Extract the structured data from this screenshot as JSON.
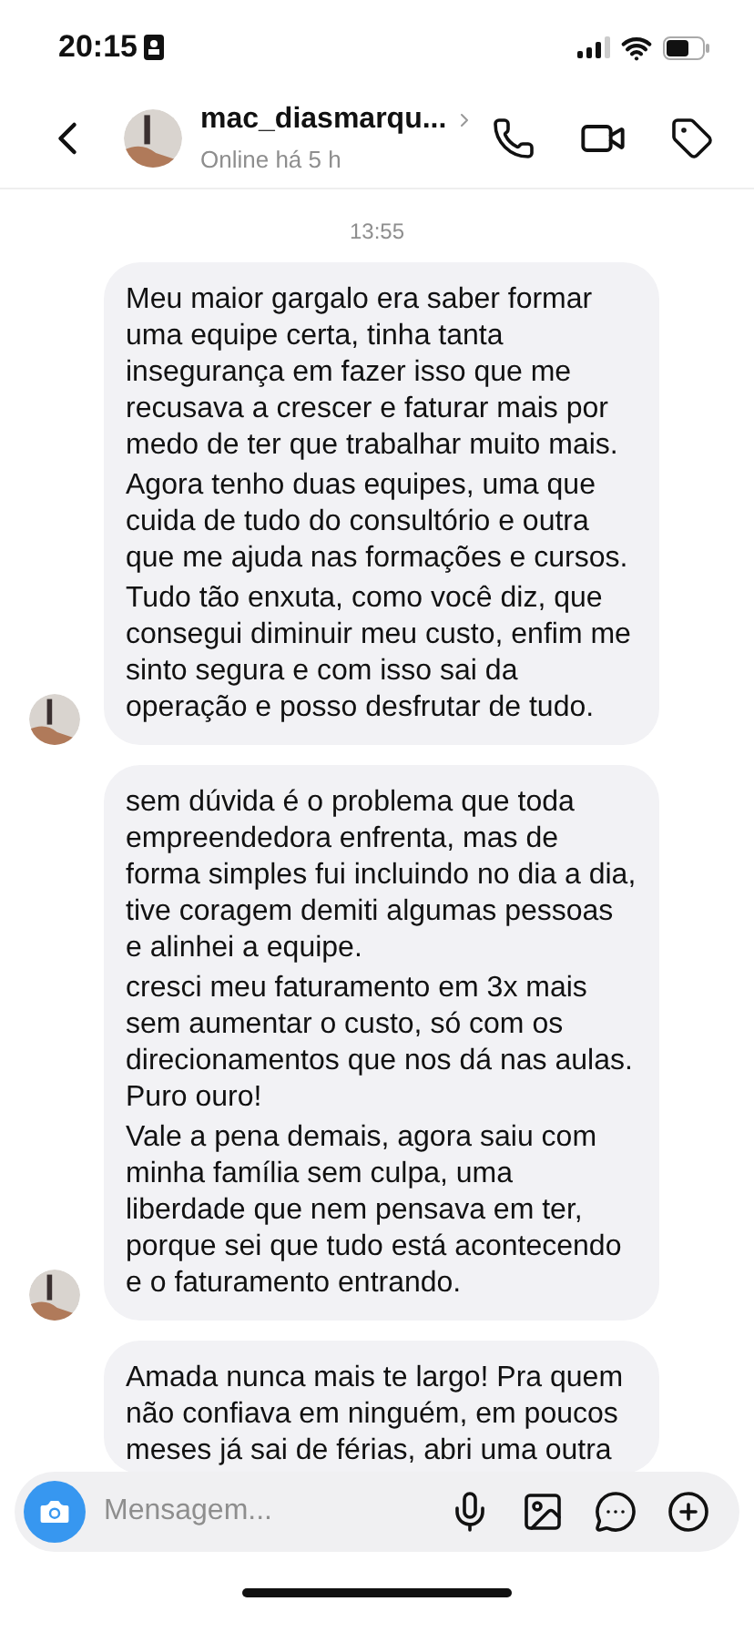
{
  "status_bar": {
    "time": "20:15"
  },
  "header": {
    "username": "mac_diasmarqu...",
    "status": "Online há 5 h"
  },
  "timestamp": "13:55",
  "messages": [
    {
      "paragraphs": [
        "Meu maior gargalo era saber formar uma equipe certa, tinha tanta insegurança em fazer isso que me recusava a crescer e faturar mais por medo de ter que trabalhar muito mais.",
        "Agora tenho duas equipes, uma que cuida de tudo do consultório e outra que me ajuda nas formações e cursos.",
        "Tudo tão enxuta, como você diz, que consegui diminuir meu custo, enfim me sinto segura e com isso sai da operação e posso desfrutar de tudo."
      ],
      "avatar": true
    },
    {
      "paragraphs": [
        "sem dúvida é o problema que toda empreendedora enfrenta, mas de forma simples fui incluindo no dia a dia, tive coragem demiti algumas pessoas e alinhei a equipe.",
        "cresci meu faturamento em 3x mais sem aumentar o custo, só com os direcionamentos que nos dá nas aulas. Puro ouro!",
        "Vale a pena demais, agora saiu com minha família sem culpa, uma liberdade que nem pensava em ter, porque sei que tudo está acontecendo e o faturamento entrando."
      ],
      "avatar": true
    },
    {
      "paragraphs": [
        "Amada nunca mais te largo! Pra quem não confiava em ninguém, em poucos meses já sai de férias, abri uma outra"
      ]
    }
  ],
  "composer": {
    "placeholder": "Mensagem..."
  }
}
